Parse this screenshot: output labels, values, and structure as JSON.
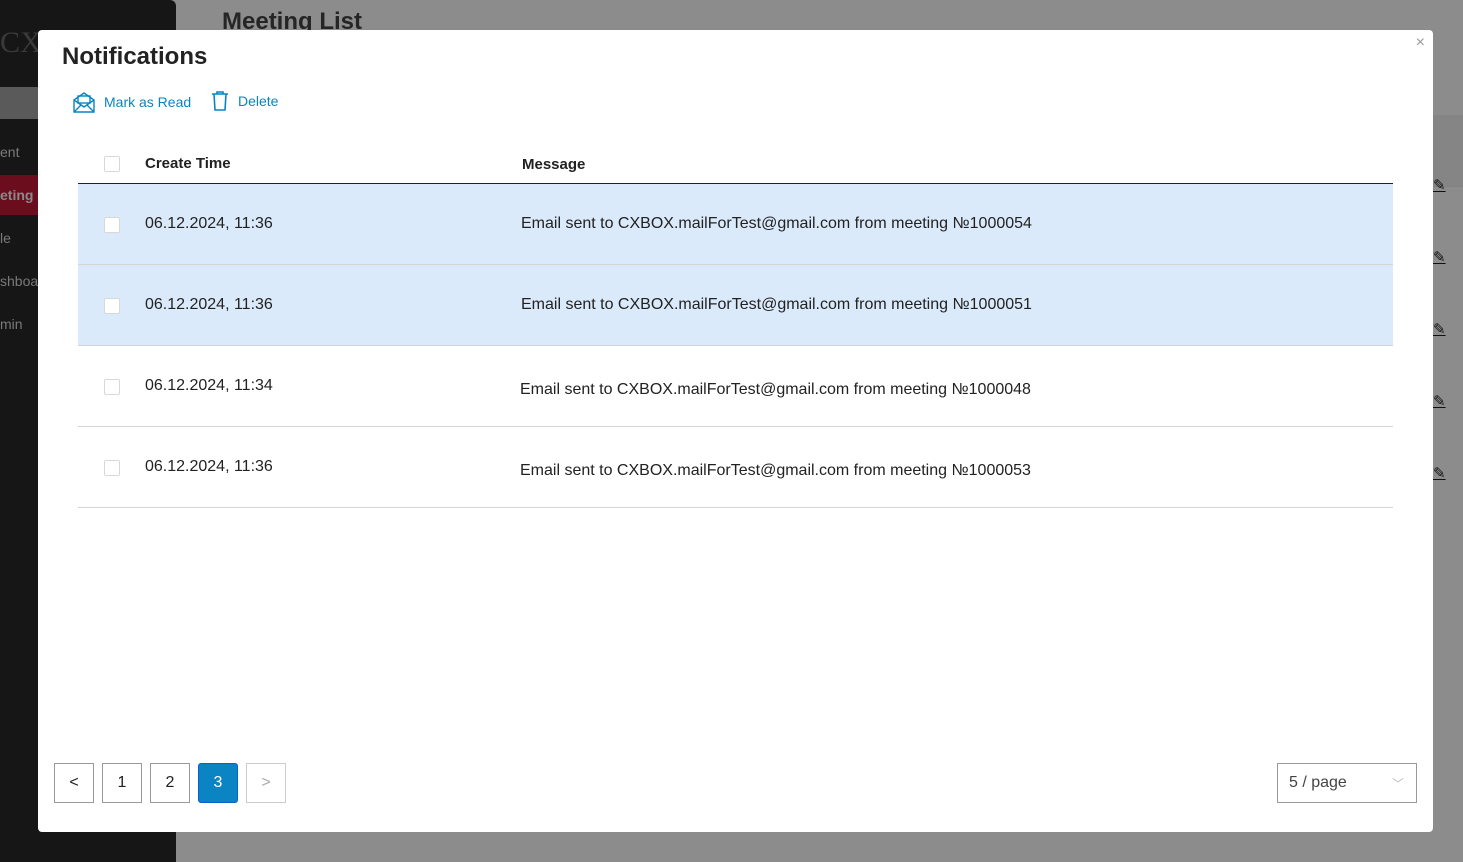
{
  "background": {
    "logo": "CX",
    "page_title": "Meeting List",
    "sidebar": [
      "ent",
      "eting",
      "le",
      "shboa",
      "min"
    ],
    "active_index": 1
  },
  "modal": {
    "title": "Notifications",
    "close": "×",
    "actions": {
      "mark_read": "Mark as Read",
      "delete": "Delete"
    },
    "columns": {
      "time": "Create Time",
      "message": "Message"
    },
    "rows": [
      {
        "time": "06.12.2024, 11:36",
        "message": "Email sent to CXBOX.mailForTest@gmail.com from meeting №1000054",
        "selected": true
      },
      {
        "time": "06.12.2024, 11:36",
        "message": "Email sent to CXBOX.mailForTest@gmail.com from meeting №1000051",
        "selected": true
      },
      {
        "time": "06.12.2024, 11:34",
        "message": "Email sent to CXBOX.mailForTest@gmail.com from meeting №1000048",
        "selected": false
      },
      {
        "time": "06.12.2024, 11:36",
        "message": "Email sent to CXBOX.mailForTest@gmail.com from meeting №1000053",
        "selected": false
      }
    ],
    "pagination": {
      "prev": "<",
      "pages": [
        "1",
        "2",
        "3"
      ],
      "current": "3",
      "next": ">",
      "page_size": "5 / page"
    }
  },
  "colors": {
    "accent": "#0a84c2",
    "selected_row": "#dbeafb"
  }
}
